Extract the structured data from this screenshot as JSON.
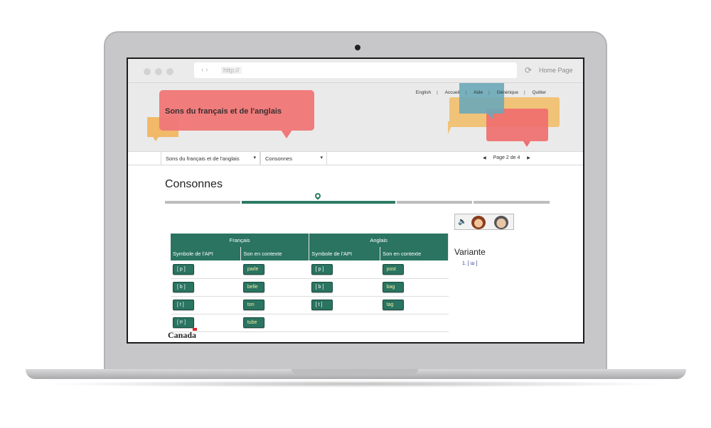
{
  "browser": {
    "url_placeholder": "http://",
    "nav_arrows": "‹  ›",
    "home_label": "Home Page"
  },
  "header": {
    "site_title": "Sons du français et de l'anglais",
    "topnav": [
      "English",
      "Accueil",
      "Aide",
      "Générique",
      "Quitter"
    ]
  },
  "nav": {
    "module_select": "Sons du français et de l'anglais",
    "section_select": "Consonnes",
    "page_label": "Page 2 de 4"
  },
  "main": {
    "title": "Consonnes",
    "progress": {
      "current_page": 2,
      "total_pages": 4
    },
    "table": {
      "groups": [
        "Français",
        "Anglais"
      ],
      "subheaders": [
        "Symbole de l'API",
        "Son en contexte",
        "Symbole de l'API",
        "Son en contexte"
      ],
      "rows": [
        {
          "fr_symbol": "[ p ]",
          "fr_word": "parle",
          "en_symbol": "[ p ]",
          "en_word": "post"
        },
        {
          "fr_symbol": "[ b ]",
          "fr_word": "belle",
          "en_symbol": "[ b ]",
          "en_word": "bag"
        },
        {
          "fr_symbol": "[ t ]",
          "fr_word": "ton",
          "en_symbol": "[ t ]",
          "en_word": "tag"
        },
        {
          "fr_symbol": "[ tˢ ]",
          "fr_word": "tube",
          "en_symbol": "",
          "en_word": ""
        }
      ]
    },
    "variante": {
      "title": "Variante",
      "items": [
        "1. [ ɯ ]"
      ]
    }
  },
  "footer": {
    "wordmark": "Canada"
  },
  "colors": {
    "accent": "#2a7461",
    "bubble_red": "#f07878",
    "bubble_orange": "#f1b968",
    "bubble_blue": "#6aa8b8"
  }
}
